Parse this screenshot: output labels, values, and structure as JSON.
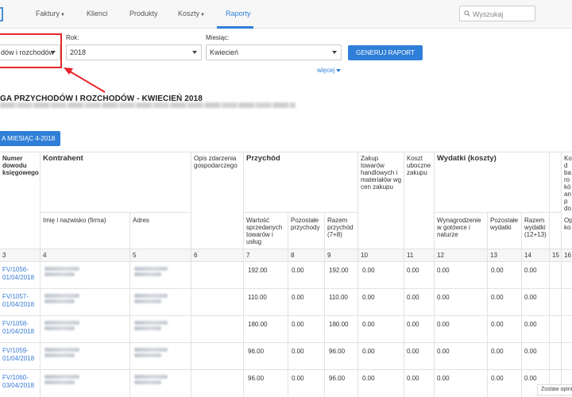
{
  "nav": {
    "items": [
      {
        "label": "Faktury",
        "dropdown": true
      },
      {
        "label": "Klienci",
        "dropdown": false
      },
      {
        "label": "Produkty",
        "dropdown": false
      },
      {
        "label": "Koszty",
        "dropdown": true
      },
      {
        "label": "Raporty",
        "dropdown": false
      }
    ],
    "active": "Raporty",
    "search_placeholder": "Wyszukaj"
  },
  "filters": {
    "type_value": "dów i rozchodów",
    "year_label": "Rok:",
    "year_value": "2018",
    "month_label": "Miesiąc:",
    "month_value": "Kwiecień",
    "generate_label": "GENERUJ RAPORT",
    "more_label": "więcej"
  },
  "report": {
    "title": "GA PRZYCHODÓW I ROZCHODÓW - KWIECIEŃ 2018",
    "month_button": "A MIESIĄC 4-2018"
  },
  "table": {
    "headers": {
      "numer": "Numer dowodu księgowego",
      "kontrahent": "Kontrahent",
      "imie": "Imię i nazwisko (firma)",
      "adres": "Adres",
      "opis": "Opis zdarzenia gospodarczego",
      "przychod": "Przychód",
      "wartosc": "Wartość sprzedanych towarów i usług",
      "pozostale_p": "Pozostałe przychody",
      "razem_p": "Razem przychód (7+8)",
      "zakup": "Zakup towarów handlowych i materiałów wg cen zakupu",
      "koszt": "Koszt uboczne zakupu",
      "wydatki": "Wydatki (koszty)",
      "wynagrodzenie": "Wynagrodzenie w gotówce i naturze",
      "pozostale_w": "Pozostałe wydatki",
      "razem_w": "Razem wydatki (12+13)",
      "last_col": "Ko d ba ro kó an p do",
      "last_sub": "Op ko"
    },
    "col_numbers": [
      "3",
      "4",
      "5",
      "6",
      "7",
      "8",
      "9",
      "10",
      "11",
      "12",
      "13",
      "14",
      "15",
      "16"
    ],
    "rows": [
      {
        "doc": "FV/1056-\n01/04/2018",
        "c7": "192.00",
        "c8": "0.00",
        "c9": "192.00",
        "c10": "0.00",
        "c11": "0.00",
        "c12": "0.00",
        "c13": "0.00",
        "c14": "0.00"
      },
      {
        "doc": "FV/1057-\n01/04/2018",
        "c7": "110.00",
        "c8": "0.00",
        "c9": "110.00",
        "c10": "0.00",
        "c11": "0.00",
        "c12": "0.00",
        "c13": "0.00",
        "c14": "0.00"
      },
      {
        "doc": "FV/1058-\n01/04/2018",
        "c7": "180.00",
        "c8": "0.00",
        "c9": "180.00",
        "c10": "0.00",
        "c11": "0.00",
        "c12": "0.00",
        "c13": "0.00",
        "c14": "0.00"
      },
      {
        "doc": "FV/1059-\n01/04/2018",
        "c7": "96.00",
        "c8": "0.00",
        "c9": "96.00",
        "c10": "0.00",
        "c11": "0.00",
        "c12": "0.00",
        "c13": "0.00",
        "c14": "0.00"
      },
      {
        "doc": "FV/1060-\n03/04/2018",
        "c7": "96.00",
        "c8": "0.00",
        "c9": "96.00",
        "c10": "0.00",
        "c11": "0.00",
        "c12": "0.00",
        "c13": "0.00",
        "c14": "0.00"
      }
    ]
  },
  "footer": {
    "zostaw": "Zostaw opini"
  },
  "colors": {
    "accent": "#2f7fd8",
    "annotation": "#e8262a"
  }
}
